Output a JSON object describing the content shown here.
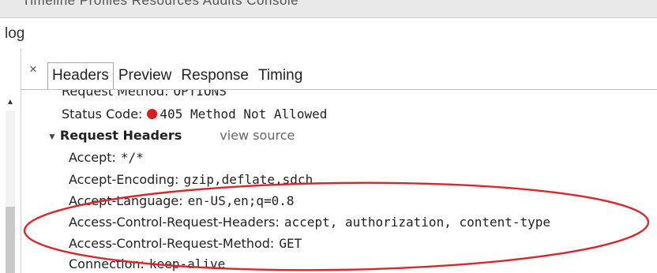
{
  "top_strip": {
    "cut_text": "Timeline  Profiles  Resources  Audits  Console"
  },
  "log_label": "log",
  "close_glyph": "×",
  "tabs": [
    {
      "label": "Headers",
      "active": true
    },
    {
      "label": "Preview",
      "active": false
    },
    {
      "label": "Response",
      "active": false
    },
    {
      "label": "Timing",
      "active": false
    }
  ],
  "general": {
    "request_method": {
      "key": "Request Method:",
      "value": "OPTIONS"
    },
    "status_code": {
      "key": "Status Code:",
      "value": "405 Method Not Allowed",
      "status_color": "#d91c1c"
    }
  },
  "request_headers": {
    "title": "Request Headers",
    "view_source": "view source",
    "items": [
      {
        "key": "Accept:",
        "value": "*/*"
      },
      {
        "key": "Accept-Encoding:",
        "value": "gzip,deflate,sdch"
      },
      {
        "key": "Accept-Language:",
        "value": "en-US,en;q=0.8"
      },
      {
        "key": "Access-Control-Request-Headers:",
        "value": "accept, authorization, content-type"
      },
      {
        "key": "Access-Control-Request-Method:",
        "value": "GET"
      },
      {
        "key": "Connection:",
        "value": "keep-alive"
      }
    ]
  },
  "annotation": {
    "color": "#d9262b"
  },
  "icons": {
    "close": "close-icon",
    "expand": "triangle-down-icon",
    "scroll_up": "scroll-up-arrow-icon"
  }
}
